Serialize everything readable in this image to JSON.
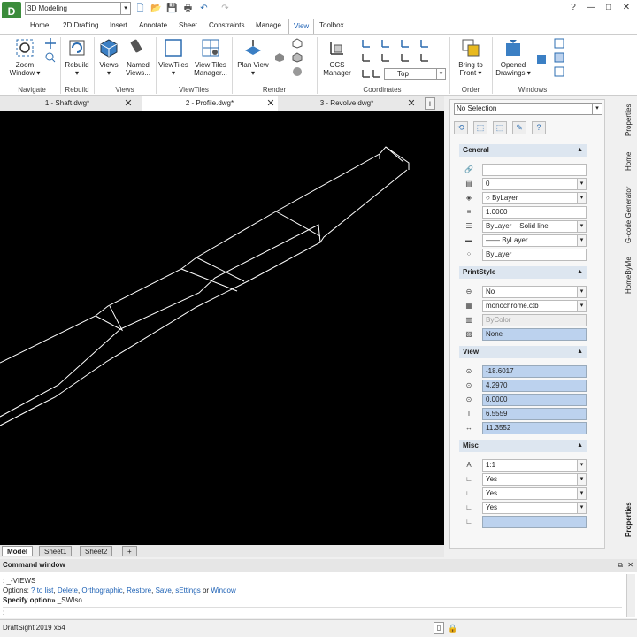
{
  "app": {
    "logo": "D",
    "workspace": "3D Modeling",
    "quick_access_icons": [
      "new-file-icon",
      "open-folder-icon",
      "save-icon",
      "print-icon",
      "undo-icon",
      "redo-icon"
    ],
    "window_buttons": [
      "?",
      "—",
      "□",
      "✕"
    ]
  },
  "ribbon": {
    "tabs": [
      "Home",
      "2D Drafting",
      "Insert",
      "Annotate",
      "Sheet",
      "Constraints",
      "Manage",
      "View",
      "Toolbox"
    ],
    "active_tab": "View",
    "buttons": {
      "zoom_window": "Zoom\nWindow ▾",
      "rebuild": "Rebuild\n▾",
      "views": "Views\n▾",
      "named_views": "Named\nViews...",
      "viewtiles": "ViewTiles\n▾",
      "viewtiles_manager": "View Tiles\nManager...",
      "plan_view": "Plan View\n▾",
      "ccs_manager": "CCS\nManager",
      "view_select": "Top",
      "bring_to_front": "Bring to\nFront ▾",
      "opened_drawings": "Opened\nDrawings ▾"
    },
    "groups": [
      "Navigate",
      "Rebuild",
      "Views",
      "ViewTiles",
      "Render",
      "Coordinates",
      "Order",
      "Windows"
    ]
  },
  "doc_tabs": [
    "1 - Shaft.dwg*",
    "2 - Profile.dwg*",
    "3 - Revolve.dwg*"
  ],
  "active_doc": 1,
  "model_tabs": [
    "Model",
    "Sheet1",
    "Sheet2"
  ],
  "properties": {
    "selection": "No Selection",
    "sections": {
      "general": "General",
      "printstyle": "PrintStyle",
      "view": "View",
      "misc": "Misc"
    },
    "general": [
      "",
      "0",
      "ByLayer",
      "1.0000",
      "ByLayer",
      "Solid line",
      "ByLayer",
      "ByLayer"
    ],
    "printstyle": [
      "No",
      "monochrome.ctb",
      "ByColor",
      "None"
    ],
    "view": [
      "-18.6017",
      "4.2970",
      "0.0000",
      "6.5559",
      "11.3552"
    ],
    "misc": [
      "1:1",
      "Yes",
      "Yes",
      "Yes",
      ""
    ]
  },
  "side_tabs": [
    "Properties",
    "Home",
    "G-code Generator",
    "HomeByMe",
    "Properties"
  ],
  "command": {
    "title": "Command window",
    "line1": ": _-VIEWS",
    "line2_prefix": "Options: ",
    "options": [
      "? to list",
      "Delete",
      "Orthographic",
      "Restore",
      "Save",
      "sEttings",
      "Window"
    ],
    "or_word": "or",
    "line3_label": "Specify option»",
    "line3_value": "_SWIso",
    "prompt": ":"
  },
  "status": {
    "text": "DraftSight 2019 x64"
  },
  "colors": {
    "accent": "#1a5fb4",
    "canvas": "#000000",
    "highlight": "#bcd2ee"
  }
}
